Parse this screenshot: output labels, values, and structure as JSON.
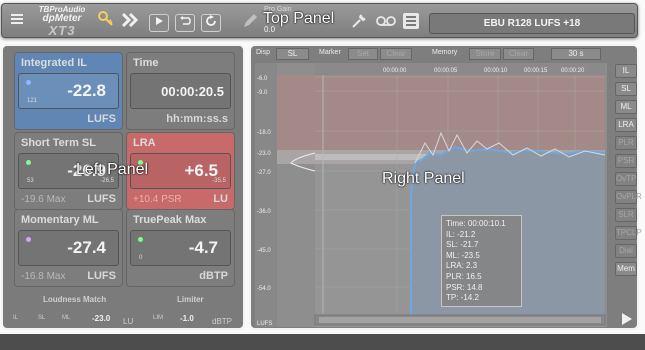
{
  "top": {
    "label": "Top Panel",
    "logo": {
      "brand": "TBProAudio",
      "name": "dpMeter",
      "version": "XT3"
    },
    "pro_gain": {
      "label": "Pro Gain",
      "value": "0.0"
    },
    "preset": "EBU R128 LUFS +18"
  },
  "left": {
    "label": "Left Panel",
    "integrated": {
      "title": "Integrated IL",
      "value": "-22.8",
      "unit": "LUFS",
      "small": "121"
    },
    "time": {
      "title": "Time",
      "value": "00:00:20.5",
      "unit": "hh:mm:ss.s"
    },
    "short_term": {
      "title": "Short Term SL",
      "value": "-26.9",
      "small": "53",
      "tiny": "-26.5",
      "sub": "-19.6 Max",
      "unit": "LUFS"
    },
    "lra": {
      "title": "LRA",
      "value": "+6.5",
      "tiny": "-35.5",
      "sub": "+10.4 PSR",
      "unit": "LU"
    },
    "momentary": {
      "title": "Momentary ML",
      "value": "-27.4",
      "sub": "-16.8 Max",
      "unit": "LUFS"
    },
    "truepeak": {
      "title": "TruePeak Max",
      "value": "-4.7",
      "small": "0",
      "unit": "dBTP"
    },
    "loudness_match": {
      "title": "Loudness Match",
      "labels": [
        "IL",
        "SL",
        "ML"
      ],
      "value": "-23.0",
      "unit": "LU"
    },
    "limiter": {
      "title": "Limiter",
      "label": "LIM",
      "value": "-1.0",
      "unit": "dBTP"
    }
  },
  "right": {
    "label": "Right Panel",
    "controls": {
      "disp_label": "Disp",
      "disp_value": "SL",
      "marker_label": "Marker",
      "marker_set": "Set",
      "marker_clear": "Clear",
      "memory_label": "Memory",
      "memory_store": "Store",
      "memory_clear": "Clear",
      "duration": "30 s"
    },
    "y_ticks": [
      "-6.0",
      "-9.0",
      "-18.0",
      "-23.0",
      "-27.0",
      "-36.0",
      "-45.0",
      "-54.0"
    ],
    "x_ticks": [
      "00:00:00",
      "00:00:05",
      "00:00:10",
      "00:00:15",
      "00:00:20"
    ],
    "y_axis_unit": "LUFS",
    "side_buttons": [
      "IL",
      "SL",
      "ML",
      "LRA",
      "PLR",
      "PSR",
      "OvTP",
      "OvPLR",
      "SLR",
      "TPCLP",
      "Dial",
      "Mem"
    ],
    "tooltip": [
      "Time: 00:00:10.1",
      "IL: -21.2",
      "SL: -21.7",
      "ML: -23.5",
      "LRA: 2.3",
      "PLR: 16.5",
      "PSR: 14.8",
      "TP: -14.2"
    ]
  },
  "colors": {
    "integrated_bg": "#5f86b4",
    "lra_bg": "#c86a6a",
    "panel_bg": "#7b7b7b",
    "dot_blue": "#8fb7ff",
    "dot_green": "#7dff8c",
    "dot_purple": "#d3a4ff"
  }
}
